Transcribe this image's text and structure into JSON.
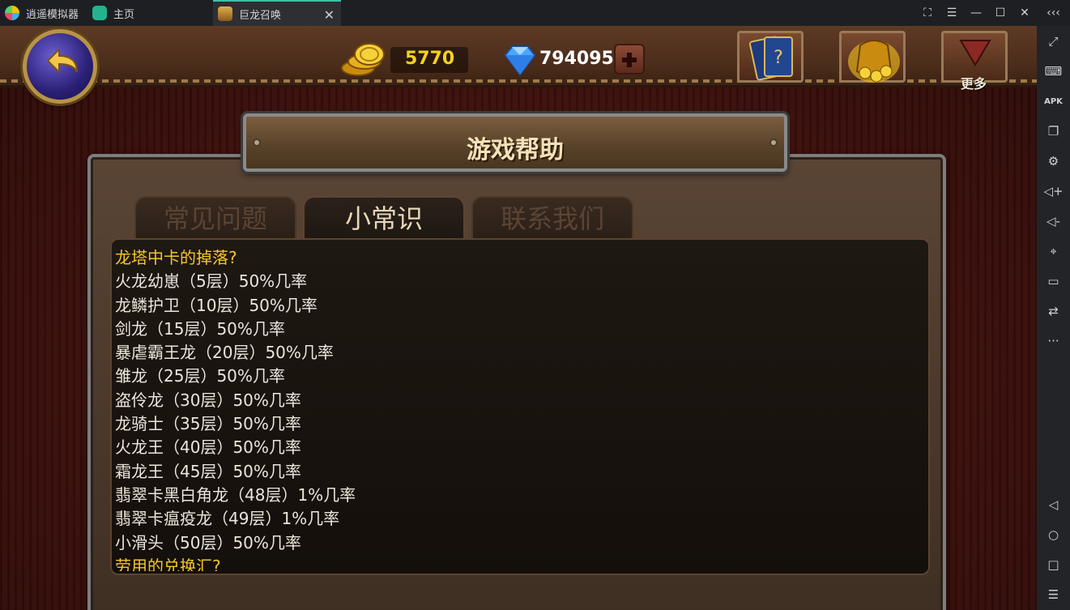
{
  "titlebar": {
    "app_name": "逍遥模拟器",
    "tabs": [
      {
        "label": "主页"
      },
      {
        "label": "巨龙召唤"
      }
    ]
  },
  "game": {
    "gold": "5770",
    "gems": "794095",
    "more_label": "更多",
    "title": "游戏帮助",
    "tabs": [
      {
        "label": "常见问题",
        "active": false
      },
      {
        "label": "小常识",
        "active": true
      },
      {
        "label": "联系我们",
        "active": false
      }
    ],
    "content": {
      "heading": "龙塔中卡的掉落?",
      "lines": [
        "火龙幼崽（5层）50%几率",
        "龙鳞护卫（10层）50%几率",
        "剑龙（15层）50%几率",
        "暴虐霸王龙（20层）50%几率",
        "雏龙（25层）50%几率",
        "盗伶龙（30层）50%几率",
        "龙骑士（35层）50%几率",
        "火龙王（40层）50%几率",
        "霜龙王（45层）50%几率",
        "翡翠卡黑白角龙（48层）1%几率",
        "翡翠卡瘟疫龙（49层）1%几率",
        "小滑头（50层）50%几率"
      ],
      "next_heading_partial": "劳用的兑换汇?"
    }
  },
  "colors": {
    "accent_tab": "#3ec1a8",
    "gold_text": "#f6d21c",
    "heading_text": "#f6c629"
  }
}
